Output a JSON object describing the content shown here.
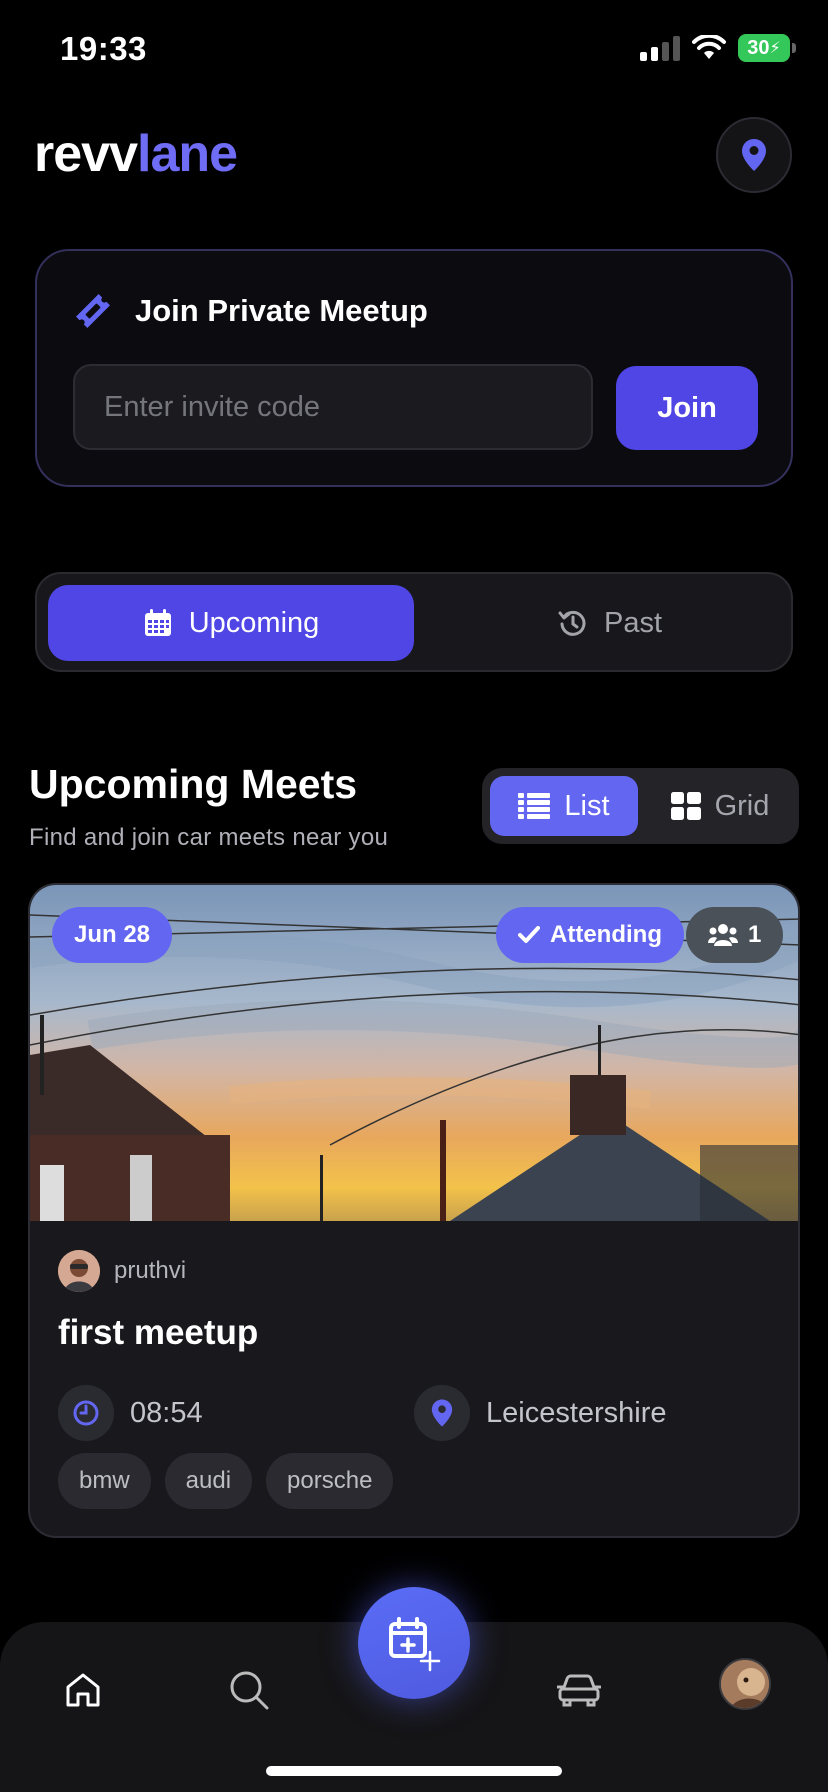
{
  "status_bar": {
    "time": "19:33",
    "battery": "30"
  },
  "header": {
    "logo_part1": "revv",
    "logo_part2": "lane",
    "location_icon": "map-pin-icon"
  },
  "private_meetup": {
    "title": "Join Private Meetup",
    "input_placeholder": "Enter invite code",
    "input_value": "",
    "join_label": "Join"
  },
  "tabs": [
    {
      "label": "Upcoming",
      "icon": "calendar-icon",
      "active": true
    },
    {
      "label": "Past",
      "icon": "history-icon",
      "active": false
    }
  ],
  "section": {
    "title": "Upcoming Meets",
    "subtitle": "Find and join car meets near you"
  },
  "view_toggle": [
    {
      "label": "List",
      "icon": "list-icon",
      "active": true
    },
    {
      "label": "Grid",
      "icon": "grid-icon",
      "active": false
    }
  ],
  "meets": [
    {
      "date": "Jun 28",
      "status": "Attending",
      "attendees": "1",
      "author": "pruthvi",
      "title": "first meetup",
      "time": "08:54",
      "location": "Leicestershire",
      "tags": [
        "bmw",
        "audi",
        "porsche"
      ]
    }
  ],
  "nav": [
    {
      "name": "home",
      "icon": "home-icon"
    },
    {
      "name": "search",
      "icon": "search-icon"
    },
    {
      "name": "create",
      "icon": "calendar-plus-icon"
    },
    {
      "name": "garage",
      "icon": "car-icon"
    },
    {
      "name": "profile",
      "icon": "avatar"
    }
  ],
  "colors": {
    "accent": "#4f46e5",
    "accent_light": "#6366f1",
    "logo_accent": "#6f6cf6",
    "background": "#000000",
    "card": "#19191d",
    "battery": "#34c759"
  }
}
